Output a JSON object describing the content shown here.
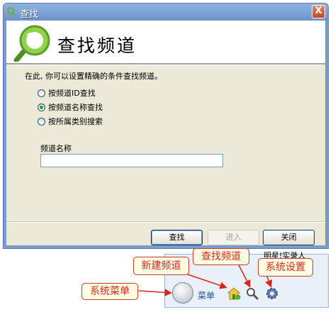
{
  "window": {
    "title": "查找",
    "close_label": "X"
  },
  "dialog": {
    "heading": "查找频道",
    "intro": "在此, 你可以设置精确的条件查找频道。",
    "options": [
      {
        "label": "按频道ID查找",
        "checked": false
      },
      {
        "label": "按频道名称查找",
        "checked": true
      },
      {
        "label": "按所属类别搜索",
        "checked": false
      }
    ],
    "field_label": "频道名称",
    "field_value": "",
    "buttons": {
      "search": "查找",
      "enter": "进入",
      "close": "关闭"
    }
  },
  "taskbar": {
    "menu_label": "菜单",
    "partial_text": "明星!实录人"
  },
  "callouts": {
    "system_menu": "系统菜单",
    "new_channel": "新建频道",
    "find_channel": "查找频道",
    "system_settings": "系统设置"
  },
  "colors": {
    "accent_red": "#d4291a",
    "titlebar": "#7c9ccc",
    "radio_selected": "#21a121"
  }
}
